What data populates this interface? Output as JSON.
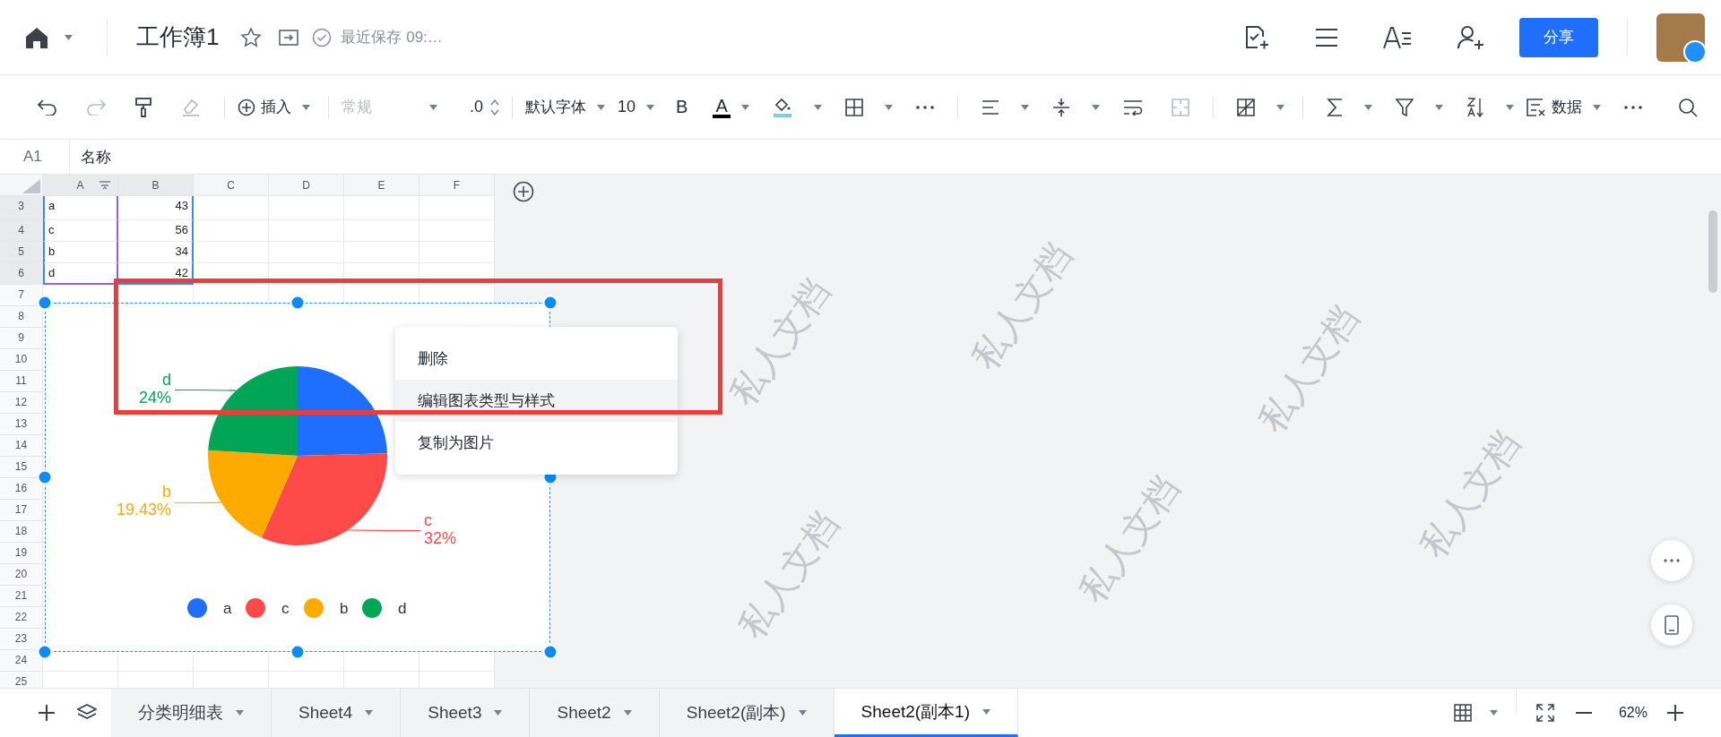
{
  "header": {
    "title": "工作簿1",
    "save_status": "最近保存 09:…",
    "share_button": "分享"
  },
  "toolbar": {
    "insert": "插入",
    "number_format": "常规",
    "decimal": ".0",
    "font": "默认字体",
    "font_size": "10",
    "bold": "B",
    "font_color": "A",
    "data": "数据"
  },
  "formula_bar": {
    "cell_ref": "A1",
    "content": "名称"
  },
  "grid": {
    "columns": [
      {
        "label": "A",
        "selected": true
      },
      {
        "label": "B",
        "selected": true
      },
      {
        "label": "C",
        "selected": false
      },
      {
        "label": "D",
        "selected": false
      },
      {
        "label": "E",
        "selected": false
      },
      {
        "label": "F",
        "selected": false
      }
    ],
    "rows": [
      {
        "number": "3",
        "selected": true,
        "label": "a",
        "value": "43"
      },
      {
        "number": "4",
        "selected": true,
        "label": "c",
        "value": "56"
      },
      {
        "number": "5",
        "selected": true,
        "label": "b",
        "value": "34"
      },
      {
        "number": "6",
        "selected": true,
        "label": "d",
        "value": "42"
      },
      {
        "number": "7",
        "selected": false
      },
      {
        "number": "8",
        "selected": false
      },
      {
        "number": "9",
        "selected": false
      },
      {
        "number": "10",
        "selected": false
      },
      {
        "number": "11",
        "selected": false
      },
      {
        "number": "12",
        "selected": false
      },
      {
        "number": "13",
        "selected": false
      },
      {
        "number": "14",
        "selected": false
      },
      {
        "number": "15",
        "selected": false
      },
      {
        "number": "16",
        "selected": false
      },
      {
        "number": "17",
        "selected": false
      },
      {
        "number": "18",
        "selected": false
      },
      {
        "number": "19",
        "selected": false
      },
      {
        "number": "20",
        "selected": false
      },
      {
        "number": "21",
        "selected": false
      },
      {
        "number": "22",
        "selected": false
      },
      {
        "number": "23",
        "selected": false
      },
      {
        "number": "24",
        "selected": false
      },
      {
        "number": "25",
        "selected": false
      }
    ]
  },
  "chart": {
    "chart_data": {
      "type": "pie",
      "categories": [
        "a",
        "c",
        "b",
        "d"
      ],
      "values": [
        24.57,
        32,
        19.43,
        24
      ],
      "colors": [
        "#1e6fff",
        "#ff4a4a",
        "#ffaa00",
        "#00a656"
      ],
      "legend": true
    },
    "slice_labels": [
      {
        "name": "d",
        "percent": "24%"
      },
      {
        "name": "b",
        "percent": "19.43%"
      },
      {
        "name": "c",
        "percent": "32%"
      }
    ]
  },
  "context_menu": [
    {
      "label": "删除",
      "selected": false
    },
    {
      "label": "编辑图表类型与样式",
      "selected": true
    },
    {
      "label": "复制为图片",
      "selected": false
    }
  ],
  "watermarks": [
    "私人文档",
    "私人文档",
    "私人文档",
    "私人文档",
    "私人文档",
    "私人文档"
  ],
  "sheet_tabs": [
    {
      "label": "分类明细表",
      "selected": false
    },
    {
      "label": "Sheet4",
      "selected": false
    },
    {
      "label": "Sheet3",
      "selected": false
    },
    {
      "label": "Sheet2",
      "selected": false
    },
    {
      "label": "Sheet2(副本)",
      "selected": false
    },
    {
      "label": "Sheet2(副本1)",
      "selected": true
    }
  ],
  "zoom_level": "62%"
}
